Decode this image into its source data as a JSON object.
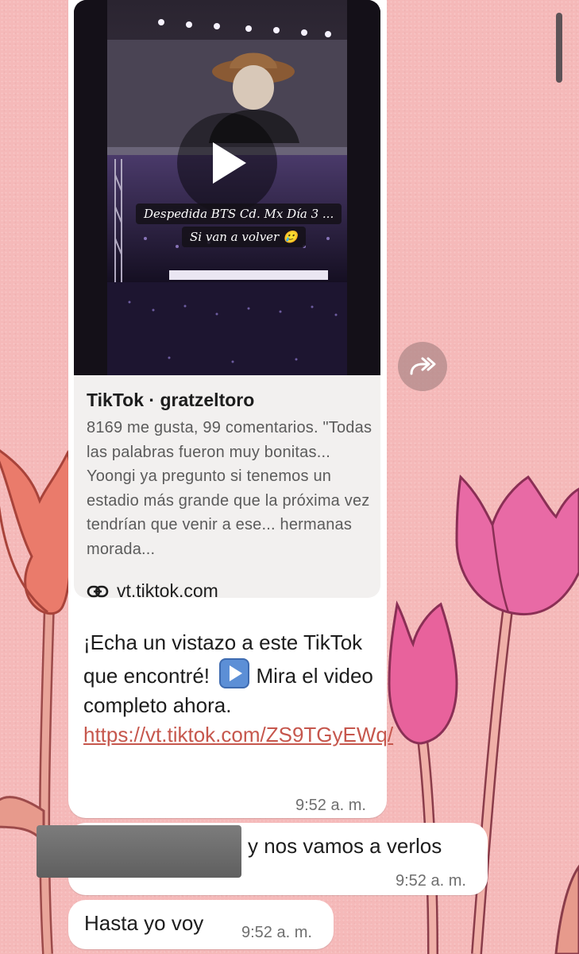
{
  "video": {
    "caption_line1": "Despedida BTS Cd. Mx Día 3 ...",
    "caption_line2": "Si van a volver 🥲",
    "play_icon": "play-icon"
  },
  "preview": {
    "title": "TikTok · gratzeltoro",
    "description": "8169 me gusta, 99 comentarios. \"Todas las palabras fueron muy bonitas... Yoongi ya pregunto si tenemos un estadio más grande que la próxima vez tendrían que venir a ese... hermanas morada...",
    "link_icon": "link-icon",
    "domain": "vt.tiktok.com"
  },
  "message1": {
    "text_part1": "¡Echa un vistazo a este TikTok que encontré!",
    "play_emoji": "play-button-emoji",
    "text_part2": "Mira el video completo ahora.",
    "url": "https://vt.tiktok.com/ZS9TGyEWq/",
    "time": "9:52 a. m."
  },
  "message2": {
    "text": "y nos vamos a verlos",
    "time": "9:52 a. m."
  },
  "message3": {
    "text": "Hasta yo voy",
    "time": "9:52 a. m."
  },
  "forward": {
    "icon": "forward-icon"
  },
  "colors": {
    "wallpaper": "#f5b9b9",
    "bubble": "#ffffff",
    "link": "#c6574d",
    "card": "#f2f0ef"
  }
}
